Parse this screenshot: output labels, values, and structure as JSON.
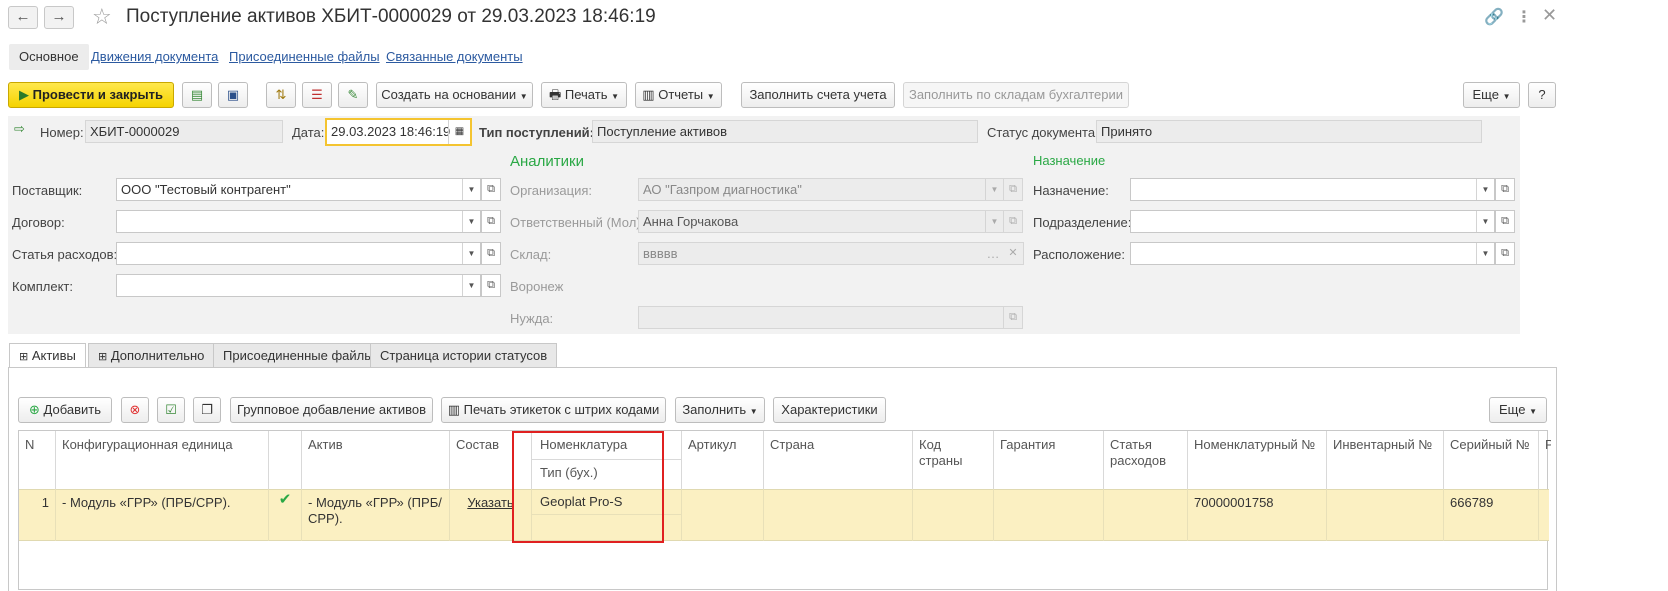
{
  "window": {
    "title": "Поступление активов ХБИТ-0000029 от 29.03.2023 18:46:19",
    "back": "←",
    "forward": "→"
  },
  "top_tabs": [
    "Основное",
    "Движения документа",
    "Присоединенные файлы",
    "Связанные документы"
  ],
  "toolbar": {
    "post_close": "Провести и закрыть",
    "create_based": "Создать на основании",
    "print": "Печать",
    "reports": "Отчеты",
    "fill_accounts": "Заполнить счета учета",
    "fill_warehouses": "Заполнить по складам бухгалтерии",
    "more": "Еще",
    "help": "?"
  },
  "header": {
    "number_label": "Номер:",
    "number": "ХБИТ-0000029",
    "date_label": "Дата:",
    "date": "29.03.2023 18:46:19",
    "type_label": "Тип поступлений:",
    "type": "Поступление активов",
    "status_label": "Статус документа:",
    "status": "Принято"
  },
  "left": {
    "supplier_label": "Поставщик:",
    "supplier": "ООО \"Тестовый контрагент\"",
    "contract_label": "Договор:",
    "contract": "",
    "expense_label": "Статья расходов:",
    "expense": "",
    "kit_label": "Комплект:",
    "kit": ""
  },
  "analytics": {
    "title": "Аналитики",
    "org_label": "Организация:",
    "org": "АО \"Газпром диагностика\"",
    "resp_label": "Ответственный (Мол):",
    "resp": "Анна Горчакова",
    "warehouse_label": "Склад:",
    "warehouse": "ввввв",
    "city": "Воронеж",
    "need_label": "Нужда:",
    "need": ""
  },
  "purpose": {
    "title": "Назначение",
    "purpose_label": "Назначение:",
    "purpose": "",
    "dept_label": "Подразделение:",
    "dept": "",
    "location_label": "Расположение:",
    "location": ""
  },
  "bottom_tabs": [
    "Активы",
    "Дополнительно",
    "Присоединенные файлы",
    "Страница истории статусов"
  ],
  "table_toolbar": {
    "add": "Добавить",
    "group_add": "Групповое добавление активов",
    "print_labels": "Печать этикеток с штрих кодами",
    "fill": "Заполнить",
    "characteristics": "Характеристики",
    "more": "Еще"
  },
  "table": {
    "columns": [
      "N",
      "Конфигурационная единица",
      "",
      "Актив",
      "Состав",
      "Номенклатура",
      "Артикул",
      "Страна",
      "Код страны",
      "Гарантия",
      "Статья расходов",
      "Номенклатурный №",
      "Инвентарный №",
      "Серийный №",
      "РН"
    ],
    "subheader": "Тип (бух.)",
    "rows": [
      {
        "n": "1",
        "unit": "- Модуль «ГРР» (ПРБ/СРР).",
        "check": "✔",
        "asset": "- Модуль «ГРР» (ПРБ/СРР).",
        "composition": "Указать",
        "nomenclature": "Geoplat Pro-S",
        "article": "",
        "country": "",
        "country_code": "",
        "warranty": "",
        "expense": "",
        "nom_no": "70000001758",
        "inv_no": "",
        "serial": "666789"
      }
    ]
  },
  "colors": {
    "accent_yellow": "#f5d300",
    "section_green": "#2aa845",
    "link_blue": "#2c5aa0",
    "row_highlight": "#fbf0c2",
    "callout_red": "#e02020"
  }
}
